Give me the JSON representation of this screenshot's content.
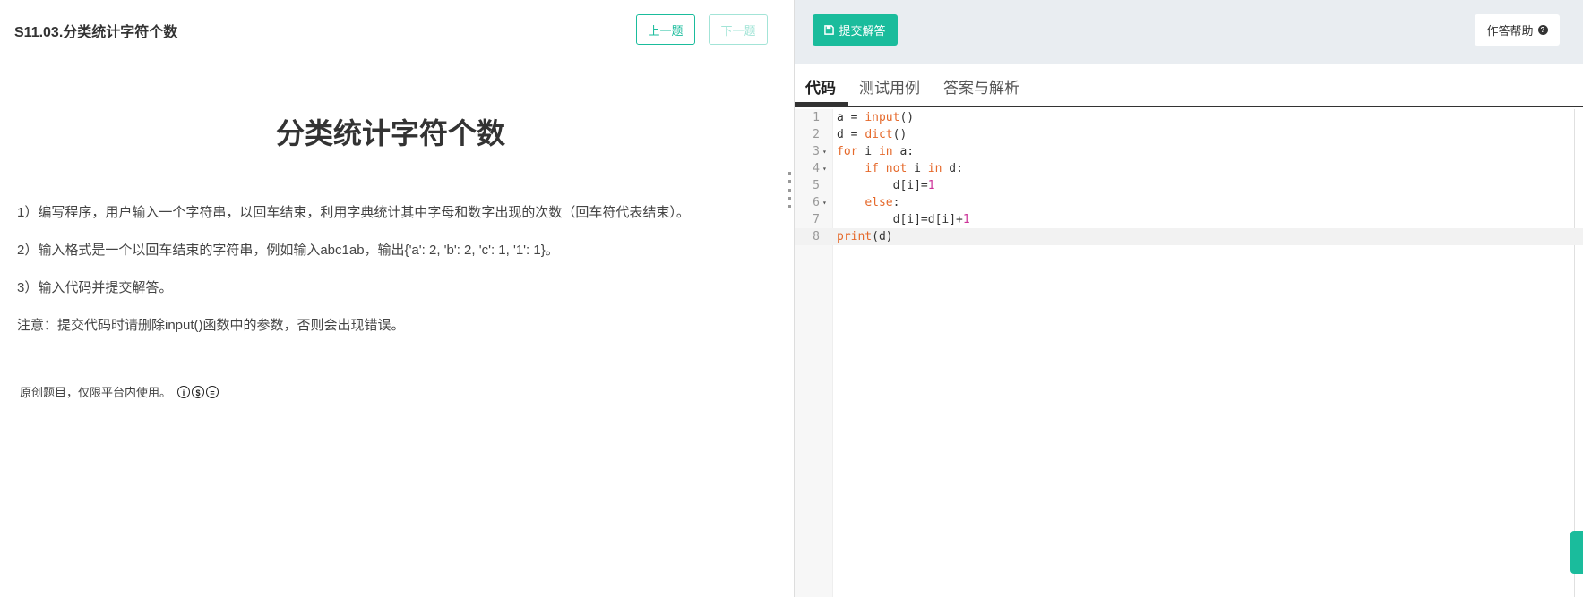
{
  "header": {
    "crumb": "S11.03.分类统计字符个数",
    "prev_label": "上一题",
    "next_label": "下一题"
  },
  "problem": {
    "title": "分类统计字符个数",
    "paragraphs": [
      "1）编写程序，用户输入一个字符串，以回车结束，利用字典统计其中字母和数字出现的次数（回车符代表结束）。",
      "2）输入格式是一个以回车结束的字符串，例如输入abc1ab，输出{'a': 2, 'b': 2, 'c': 1, '1': 1}。",
      "3）输入代码并提交解答。",
      "注意：提交代码时请删除input()函数中的参数，否则会出现错误。"
    ],
    "source_note": "原创题目，仅限平台内使用。",
    "license_icons": [
      "cc-by-icon",
      "cc-nc-icon",
      "cc-nd-icon"
    ]
  },
  "toolbar": {
    "submit_label": "提交解答",
    "submit_icon": "save-icon",
    "help_label": "作答帮助",
    "help_icon": "question-circle-icon",
    "accent": "#1abc9c"
  },
  "tabs": [
    {
      "label": "代码",
      "active": true
    },
    {
      "label": "测试用例",
      "active": false
    },
    {
      "label": "答案与解析",
      "active": false
    }
  ],
  "editor": {
    "line_numbers": [
      "1",
      "2",
      "3",
      "4",
      "5",
      "6",
      "7",
      "8"
    ],
    "lines": [
      "a = input()",
      "d = dict()",
      "for i in a:",
      "    if not i in d:",
      "        d[i]=1",
      "    else:",
      "        d[i]=d[i]+1",
      "print(d)"
    ],
    "active_line": "8"
  }
}
